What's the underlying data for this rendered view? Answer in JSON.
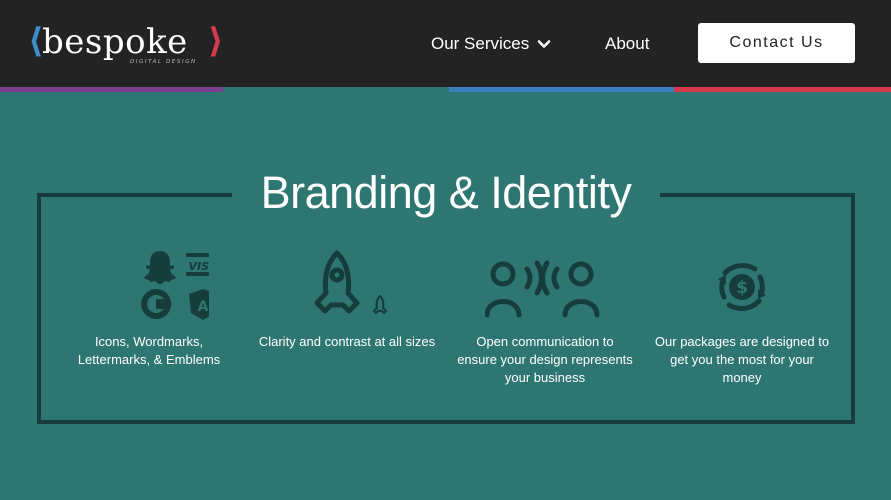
{
  "header": {
    "logo": {
      "left_bracket": "⟨",
      "word": "bespoke",
      "right_bracket": "⟩",
      "tagline": "DIGITAL DESIGN"
    },
    "nav": {
      "services_label": "Our Services",
      "about_label": "About",
      "contact_label": "Contact Us"
    }
  },
  "stripes": {
    "colors": [
      "#7a3f8f",
      "#2e7672",
      "#3a7fbf",
      "#d43a4e"
    ]
  },
  "section": {
    "title": "Branding & Identity",
    "features": [
      {
        "icon": "brand-logos-icon",
        "caption_lines": [
          "Icons, Wordmarks,",
          "Lettermarks, & Emblems"
        ]
      },
      {
        "icon": "rocket-icon",
        "caption_lines": [
          "Clarity and contrast at all sizes"
        ]
      },
      {
        "icon": "communication-icon",
        "caption_lines": [
          "Open communication to",
          "ensure your design represents",
          "your business"
        ]
      },
      {
        "icon": "money-cycle-icon",
        "caption_lines": [
          "Our packages are designed to",
          "get you the most for your",
          "money"
        ]
      }
    ]
  },
  "colors": {
    "header_bg": "#232323",
    "page_bg": "#2e7672",
    "dark_teal": "#163d3b",
    "white": "#ffffff"
  }
}
